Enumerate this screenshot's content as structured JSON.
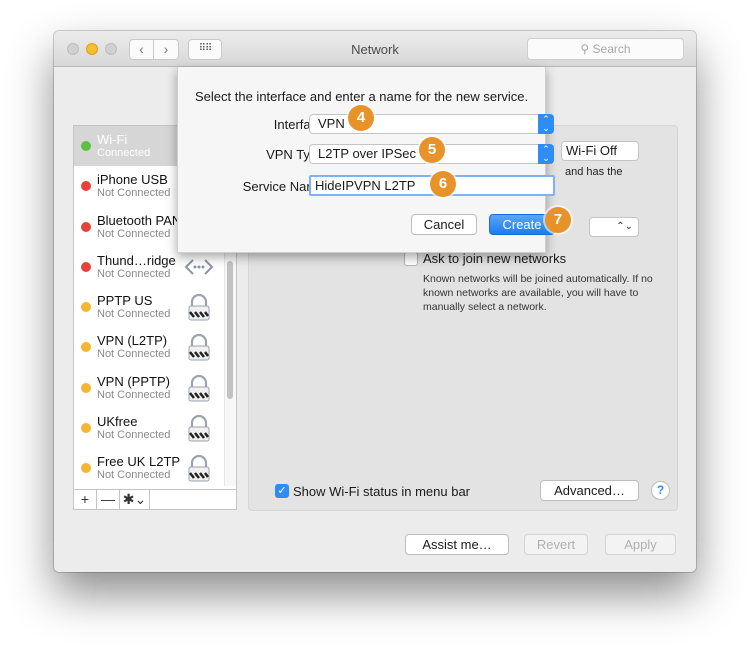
{
  "window": {
    "title": "Network",
    "search_placeholder": "Search",
    "nav_back": "‹",
    "nav_forward": "›",
    "grid_glyph": "⠿⠿"
  },
  "sidebar": {
    "services": [
      {
        "name": "Wi-Fi",
        "status": "Connected",
        "dot_color": "#5ec040",
        "icon": "none",
        "selected": true
      },
      {
        "name": "iPhone USB",
        "status": "Not Connected",
        "dot_color": "#e8403a",
        "icon": "none"
      },
      {
        "name": "Bluetooth PAN",
        "status": "Not Connected",
        "dot_color": "#e8403a",
        "icon": "none"
      },
      {
        "name": "Thund…ridge",
        "status": "Not Connected",
        "dot_color": "#e8403a",
        "icon": "thunderbolt-bridge-icon"
      },
      {
        "name": "PPTP US",
        "status": "Not Connected",
        "dot_color": "#f5b630",
        "icon": "vpn-lock-icon"
      },
      {
        "name": "VPN (L2TP)",
        "status": "Not Connected",
        "dot_color": "#f5b630",
        "icon": "vpn-lock-icon"
      },
      {
        "name": "VPN (PPTP)",
        "status": "Not Connected",
        "dot_color": "#f5b630",
        "icon": "vpn-lock-icon"
      },
      {
        "name": "UKfree",
        "status": "Not Connected",
        "dot_color": "#f5b630",
        "icon": "vpn-lock-icon"
      },
      {
        "name": "Free UK L2TP",
        "status": "Not Connected",
        "dot_color": "#f5b630",
        "icon": "vpn-lock-icon"
      }
    ],
    "add_label": "+",
    "remove_label": "—",
    "gear_label": "✱⌄"
  },
  "panel": {
    "wifi_off_label": "Wi-Fi Off",
    "partial_text": "and has the",
    "network_select_arrows": "⌃⌄",
    "ask_join_label": "Ask to join new networks",
    "ask_join_checked": false,
    "ask_join_desc": "Known networks will be joined automatically. If no known networks are available, you will have to manually select a network.",
    "show_status_label": "Show Wi-Fi status in menu bar",
    "show_status_checked": true,
    "advanced_label": "Advanced…",
    "help_label": "?"
  },
  "footer": {
    "assist_label": "Assist me…",
    "revert_label": "Revert",
    "apply_label": "Apply"
  },
  "sheet": {
    "message": "Select the interface and enter a name for the new service.",
    "interface_label": "Interface:",
    "interface_value": "VPN",
    "vpn_type_label": "VPN Type:",
    "vpn_type_value": "L2TP over IPSec",
    "service_name_label": "Service Name:",
    "service_name_value": "HideIPVPN L2TP",
    "cancel_label": "Cancel",
    "create_label": "Create",
    "popup_arrows": "⌃⌄"
  },
  "annotations": {
    "step4": "4",
    "step5": "5",
    "step6": "6",
    "step7": "7",
    "color": "#e8922a"
  }
}
